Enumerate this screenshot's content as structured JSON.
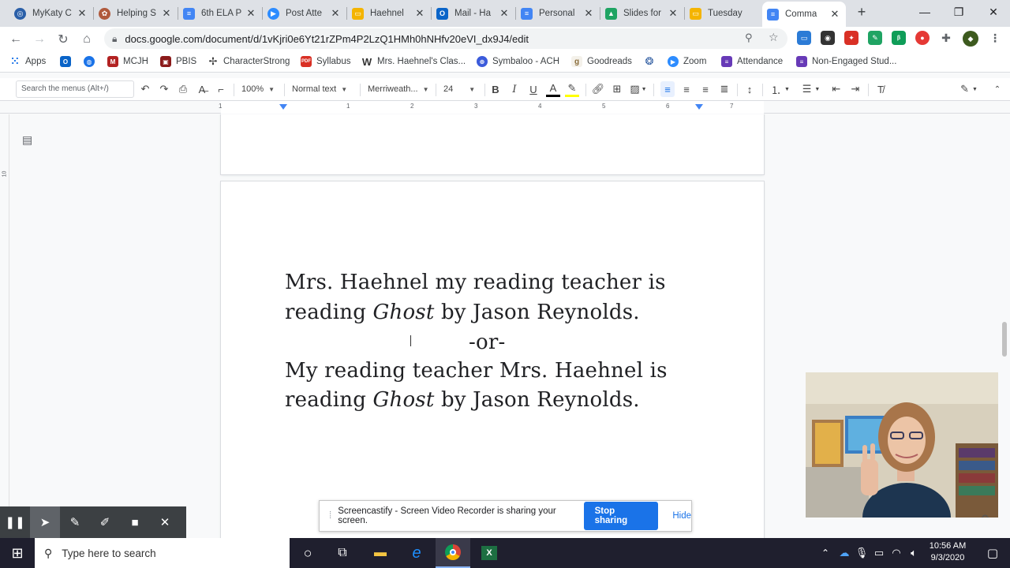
{
  "browser": {
    "tabs": [
      {
        "title": "MyKaty C",
        "icon": "mykaty-icon",
        "color": "#2a5fa8",
        "active": false
      },
      {
        "title": "Helping S",
        "icon": "helping-icon",
        "color": "#b05a3c",
        "active": false
      },
      {
        "title": "6th ELA P",
        "icon": "google-docs-icon",
        "color": "#4285f4",
        "active": false
      },
      {
        "title": "Post Atte",
        "icon": "zoom-icon",
        "color": "#2d8cff",
        "active": false
      },
      {
        "title": "Haehnel",
        "icon": "google-slides-icon",
        "color": "#f4b400",
        "active": false
      },
      {
        "title": "Mail - Ha",
        "icon": "outlook-icon",
        "color": "#0a64c8",
        "active": false
      },
      {
        "title": "Personal",
        "icon": "google-docs-icon",
        "color": "#4285f4",
        "active": false
      },
      {
        "title": "Slides for",
        "icon": "google-drive-icon",
        "color": "#1fa463",
        "active": false
      },
      {
        "title": "Tuesday",
        "icon": "google-slides-icon",
        "color": "#f4b400",
        "active": false
      },
      {
        "title": "Comma",
        "icon": "google-docs-icon",
        "color": "#4285f4",
        "active": true
      }
    ],
    "new_tab_label": "+",
    "url": "docs.google.com/document/d/1vKjri0e6Yt21rZPm4P2LzQ1HMh0hNHfv20eVI_dx9J4/edit"
  },
  "bookmarks": [
    {
      "label": "Apps",
      "icon": "apps-grid-icon",
      "color": "#5f6368"
    },
    {
      "label": "",
      "icon": "outlook-icon",
      "color": "#0a64c8"
    },
    {
      "label": "",
      "icon": "globe-icon",
      "color": "#1a73e8"
    },
    {
      "label": "MCJH",
      "icon": "mcjh-icon",
      "color": "#b22222"
    },
    {
      "label": "PBIS",
      "icon": "pbis-icon",
      "color": "#8b1a1a"
    },
    {
      "label": "CharacterStrong",
      "icon": "character-strong-icon",
      "color": "#333333"
    },
    {
      "label": "Syllabus",
      "icon": "pdf-icon",
      "color": "#d93025"
    },
    {
      "label": "Mrs. Haehnel's Clas...",
      "icon": "weebly-icon",
      "color": "#333333"
    },
    {
      "label": "Symbaloo - ACH",
      "icon": "symbaloo-icon",
      "color": "#3b5bdb"
    },
    {
      "label": "Goodreads",
      "icon": "goodreads-icon",
      "color": "#8a6d3b"
    },
    {
      "label": "",
      "icon": "edpuzzle-icon",
      "color": "#2c5aa0"
    },
    {
      "label": "Zoom",
      "icon": "zoom-icon",
      "color": "#2d8cff"
    },
    {
      "label": "Attendance",
      "icon": "google-forms-icon",
      "color": "#673ab7"
    },
    {
      "label": "Non-Engaged Stud...",
      "icon": "google-forms-icon",
      "color": "#673ab7"
    }
  ],
  "toolbar": {
    "menu_search_placeholder": "Search the menus (Alt+/)",
    "zoom": "100%",
    "style": "Normal text",
    "font": "Merriweath...",
    "font_size": "24"
  },
  "ruler": {
    "numbers": [
      "1",
      "1",
      "2",
      "3",
      "4",
      "5",
      "6",
      "7"
    ]
  },
  "document": {
    "line1": "Mrs. Haehnel my reading teacher is",
    "line2_pre": "reading ",
    "book": "Ghost",
    "line2_post": " by Jason Reynolds.",
    "separator": "-or-",
    "line3": "My reading teacher Mrs. Haehnel is",
    "line4_pre": "reading ",
    "line4_post": " by Jason Reynolds."
  },
  "share_banner": {
    "message": "Screencastify - Screen Video Recorder is sharing your screen.",
    "stop_label": "Stop sharing",
    "hide_label": "Hide"
  },
  "taskbar": {
    "search_placeholder": "Type here to search",
    "time": "10:56 AM",
    "date": "9/3/2020"
  }
}
